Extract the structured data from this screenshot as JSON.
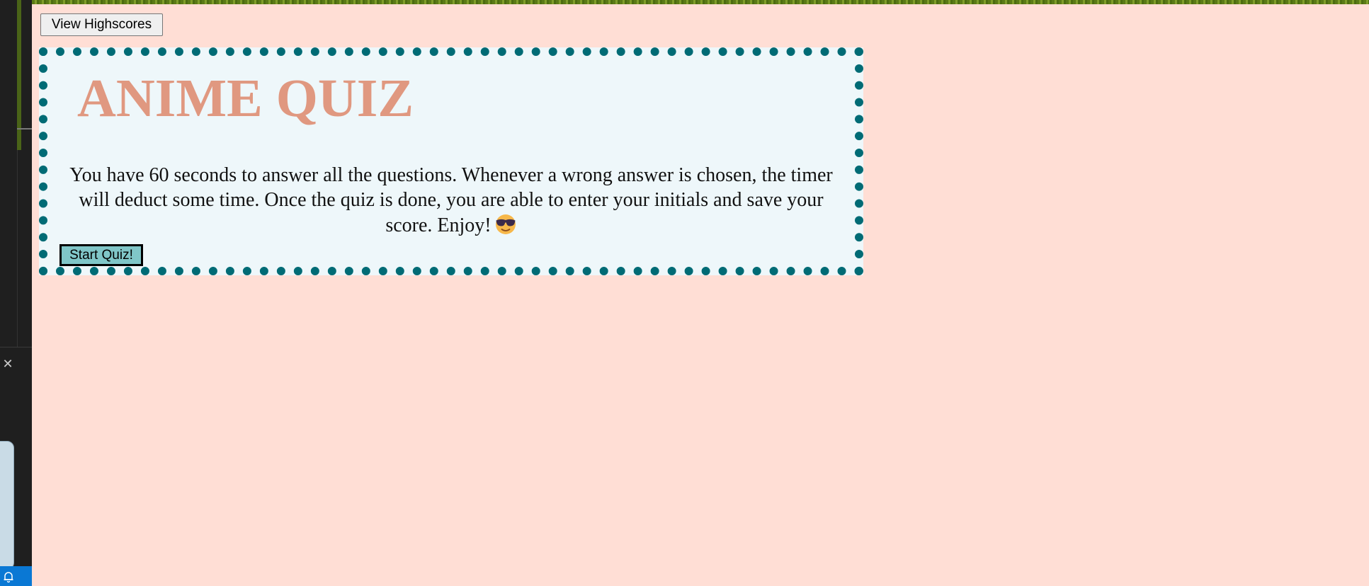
{
  "header": {
    "highscores_label": "View Highscores"
  },
  "quiz": {
    "title": "ANIME QUIZ",
    "description": "You have 60 seconds to answer all the questions. Whenever a wrong answer is chosen, the timer will deduct some time. Once the quiz is done, you are able to enter your initials and save your score. Enjoy!",
    "emoji": "smiling-face-with-sunglasses-icon",
    "start_label": "Start Quiz!"
  },
  "colors": {
    "page_background": "#ffded5",
    "card_background": "#eef7fa",
    "card_border": "#006b75",
    "title": "#e09880",
    "start_button": "#80c6c8"
  }
}
